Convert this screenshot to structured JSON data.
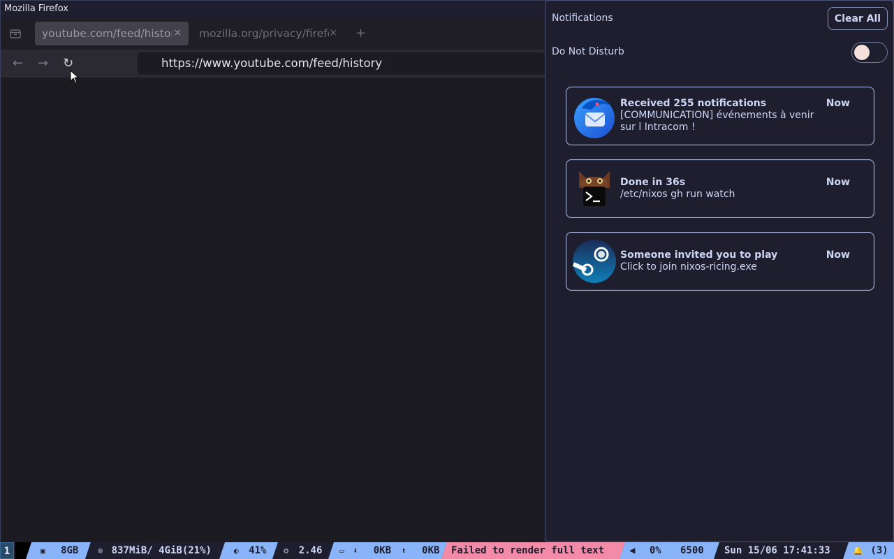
{
  "window": {
    "title": "Mozilla Firefox"
  },
  "tabs": [
    {
      "title": "youtube.com/feed/history",
      "close": "×"
    },
    {
      "title": "mozilla.org/privacy/firefox",
      "close": "×"
    }
  ],
  "new_tab": "+",
  "navbar": {
    "back": "←",
    "forward": "→",
    "reload": "↻",
    "url": "https://www.youtube.com/feed/history"
  },
  "notifications": {
    "title": "Notifications",
    "clear_all": "Clear All",
    "dnd_label": "Do Not Disturb",
    "dnd_enabled": false,
    "items": [
      {
        "icon": "thunderbird-icon",
        "summary": "Received 255 notifications",
        "time": "Now",
        "body": "[COMMUNICATION] événements à venir sur l Intracom !"
      },
      {
        "icon": "terminal-cat-icon",
        "summary": "Done in 36s",
        "time": "Now",
        "body": "/etc/nixos gh run watch"
      },
      {
        "icon": "steam-icon",
        "summary": "Someone invited you to play",
        "time": "Now",
        "body": "Click to join nixos-ricing.exe"
      }
    ]
  },
  "statusbar": {
    "workspace": "1",
    "disk": "8GB",
    "memory": "837MiB/ 4GiB(21%)",
    "cpu": "41%",
    "load": "2.46",
    "net_down": "0KB",
    "net_up": "0KB",
    "error": "Failed to render full text",
    "volume": "0%",
    "temperature": "6500",
    "clock": "Sun 15/06 17:41:33",
    "notif_count": "(3)",
    "colors": {
      "blue": "#89b4fa",
      "red": "#f38ba8",
      "dark": "#1e1e2e"
    }
  }
}
